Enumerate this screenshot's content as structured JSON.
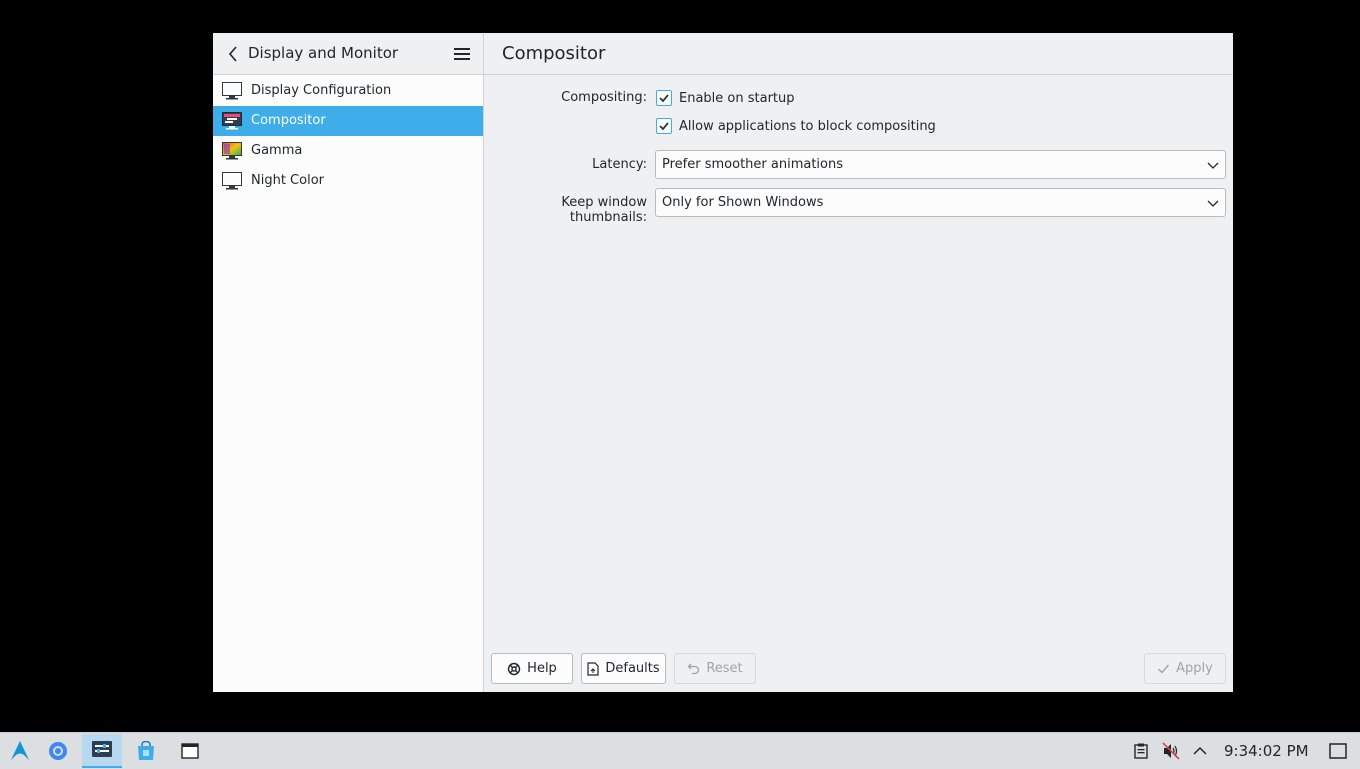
{
  "sidebar": {
    "title": "Display and Monitor",
    "items": [
      {
        "label": "Display Configuration",
        "icon": "monitor-icon"
      },
      {
        "label": "Compositor",
        "icon": "compositor-icon",
        "selected": true
      },
      {
        "label": "Gamma",
        "icon": "gamma-icon"
      },
      {
        "label": "Night Color",
        "icon": "monitor-icon"
      }
    ]
  },
  "main": {
    "title": "Compositor",
    "compositing_label": "Compositing:",
    "enable_startup_label": "Enable on startup",
    "enable_startup_checked": true,
    "allow_block_label": "Allow applications to block compositing",
    "allow_block_checked": true,
    "latency_label": "Latency:",
    "latency_value": "Prefer smoother animations",
    "thumbnails_label": "Keep window thumbnails:",
    "thumbnails_value": "Only for Shown Windows"
  },
  "buttons": {
    "help": "Help",
    "defaults": "Defaults",
    "reset": "Reset",
    "apply": "Apply"
  },
  "taskbar": {
    "clock": "9:34:02 PM"
  },
  "colors": {
    "accent": "#3daee9",
    "background": "#eff0f1",
    "sidebar_bg": "#fcfcfc"
  }
}
